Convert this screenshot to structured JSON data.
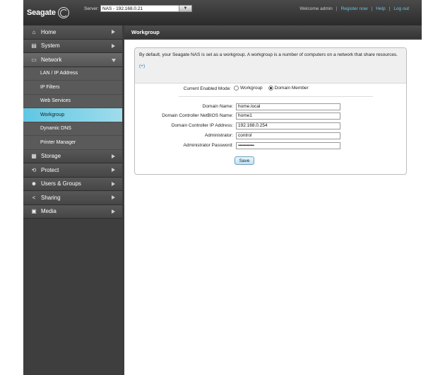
{
  "brand": {
    "name": "Seagate"
  },
  "server": {
    "label": "Server:",
    "value": "NAS - 192.168.0.21"
  },
  "topnav": {
    "welcome": "Welcome admin",
    "register": "Register now",
    "help": "Help",
    "logout": "Log out"
  },
  "sidebar": {
    "items": [
      {
        "label": "Home",
        "icon": "home-icon"
      },
      {
        "label": "System",
        "icon": "system-icon"
      },
      {
        "label": "Network",
        "icon": "network-icon"
      },
      {
        "label": "Storage",
        "icon": "storage-icon"
      },
      {
        "label": "Protect",
        "icon": "protect-icon"
      },
      {
        "label": "Users & Groups",
        "icon": "users-icon"
      },
      {
        "label": "Sharing",
        "icon": "sharing-icon"
      },
      {
        "label": "Media",
        "icon": "media-icon"
      }
    ],
    "network_sub": [
      "LAN / IP Address",
      "IP Filters",
      "Web Services",
      "Workgroup",
      "Dynamic DNS",
      "Printer Manager"
    ]
  },
  "page": {
    "title": "Workgroup",
    "info": "By default, your Seagate NAS is set as a workgroup. A workgroup is a number of computers on a network that share resources.",
    "more": "(+)",
    "mode_label": "Current Enabled Mode:",
    "mode_options": [
      "Workgroup",
      "Domain Member"
    ],
    "mode_selected": "Domain Member",
    "fields": [
      {
        "label": "Domain Name:",
        "value": "home.local"
      },
      {
        "label": "Domain Controller NetBIOS Name:",
        "value": "home1"
      },
      {
        "label": "Domain Controller IP Address:",
        "value": "192.168.0.254"
      },
      {
        "label": "Administrator:",
        "value": "control"
      },
      {
        "label": "Administrator Password:",
        "value": "••••••••••••••••••"
      }
    ],
    "save_label": "Save"
  }
}
